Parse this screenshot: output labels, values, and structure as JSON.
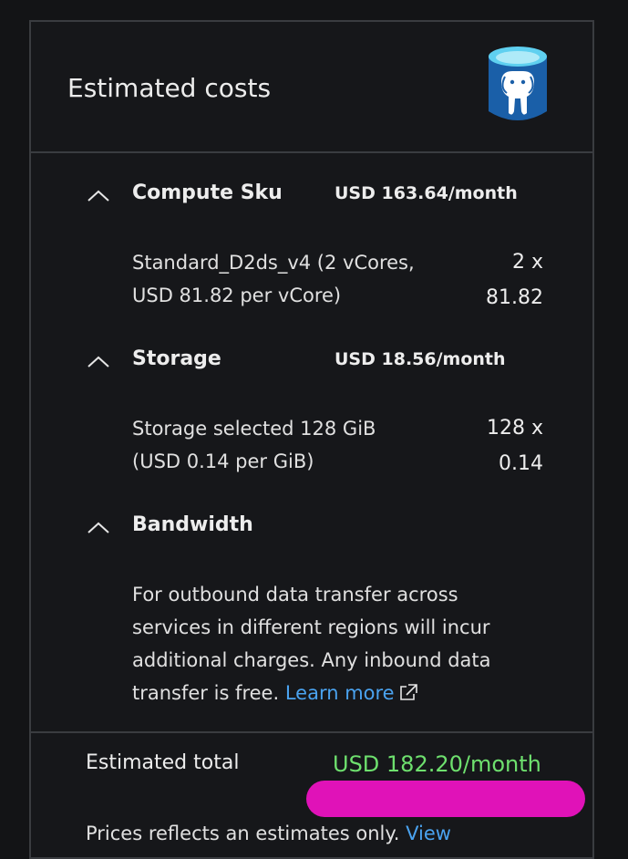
{
  "header": {
    "title": "Estimated costs",
    "icon": "postgresql-database-icon"
  },
  "sections": [
    {
      "title": "Compute Sku",
      "amount": "USD 163.64/month",
      "detail_line1": "Standard_D2ds_v4 (2 vCores,",
      "detail_line2": "USD 81.82 per vCore)",
      "mult_line1": "2 x",
      "mult_line2": "81.82"
    },
    {
      "title": "Storage",
      "amount": "USD 18.56/month",
      "detail_line1": "Storage selected 128 GiB",
      "detail_line2": "(USD 0.14 per GiB)",
      "mult_line1": "128 x",
      "mult_line2": "0.14"
    },
    {
      "title": "Bandwidth",
      "text_line1": "For outbound data transfer across",
      "text_line2": "services in different regions will incur",
      "text_line3": "additional charges. Any inbound data",
      "text_line4": "transfer is free. ",
      "link": "Learn more"
    }
  ],
  "total": {
    "label": "Estimated total",
    "value": "USD 182.20/month"
  },
  "note": {
    "text": "Prices reflects an estimates only. ",
    "link": "View"
  },
  "colors": {
    "background": "#16171a",
    "border": "#3a3c40",
    "link": "#4aa3f0",
    "total": "#6ee06e",
    "redaction": "#e012b8"
  }
}
